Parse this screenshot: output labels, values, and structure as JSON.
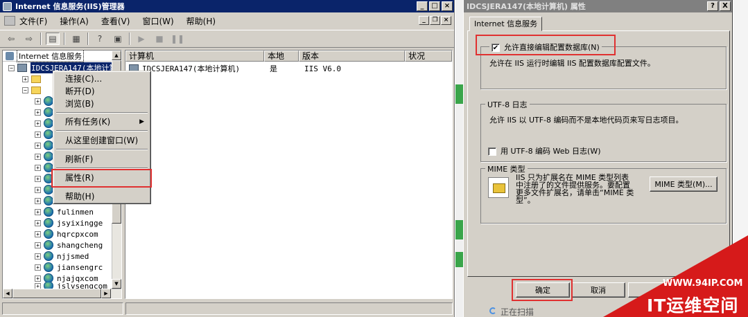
{
  "iis": {
    "title": "Internet 信息服务(IIS)管理器",
    "menu": [
      "文件(F)",
      "操作(A)",
      "查看(V)",
      "窗口(W)",
      "帮助(H)"
    ],
    "tree_header": "Internet 信息服务",
    "tree_root": "IDCSJERA147(本地计算",
    "tree_sites": [
      "fulinmen",
      "jsyixingge",
      "hqrcpxcom",
      "shangcheng",
      "njjsmed",
      "jiansengrc",
      "njajqxcom",
      "jslvsengcom"
    ],
    "list_headers": [
      "计算机",
      "本地",
      "版本",
      "状况"
    ],
    "list_row": {
      "computer": "IDCSJERA147(本地计算机)",
      "local": "是",
      "version": "IIS V6.0"
    }
  },
  "context_menu": {
    "connect": "连接(C)...",
    "disconnect": "断开(D)",
    "browse": "浏览(B)",
    "all_tasks": "所有任务(K)",
    "new_window": "从这里创建窗口(W)",
    "refresh": "刷新(F)",
    "properties": "属性(R)",
    "help": "帮助(H)"
  },
  "dialog": {
    "title": "IDCSJERA147(本地计算机) 属性",
    "help_btn": "?",
    "close_btn": "X",
    "tab": "Internet 信息服务",
    "direct_edit_label": "允许直接编辑配置数据库(N)",
    "direct_edit_checked": true,
    "direct_edit_desc": "允许在 IIS 运行时编辑 IIS 配置数据库配置文件。",
    "utf8_group": "UTF-8 日志",
    "utf8_desc": "允许 IIS 以 UTF-8 编码而不是本地代码页来写日志项目。",
    "utf8_checkbox": "用 UTF-8 编码 Web 日志(W)",
    "utf8_checked": false,
    "mime_group": "MIME 类型",
    "mime_desc_1": "IIS 只为扩展名在 MIME 类型列表",
    "mime_desc_2": "中注册了的文件提供服务。要配置",
    "mime_desc_3": "更多文件扩展名，请单击“MIME 类",
    "mime_desc_4": "型”。",
    "mime_button": "MIME 类型(M)...",
    "ok": "确定",
    "cancel": "取消"
  },
  "background": {
    "scanning": "正在扫描"
  },
  "watermark": {
    "url": "WWW.94IP.COM",
    "brand": "IT运维空间"
  },
  "colors": {
    "highlight": "#e03030",
    "titlebar_active": "#0a246a",
    "watermark": "#d61a1a"
  }
}
